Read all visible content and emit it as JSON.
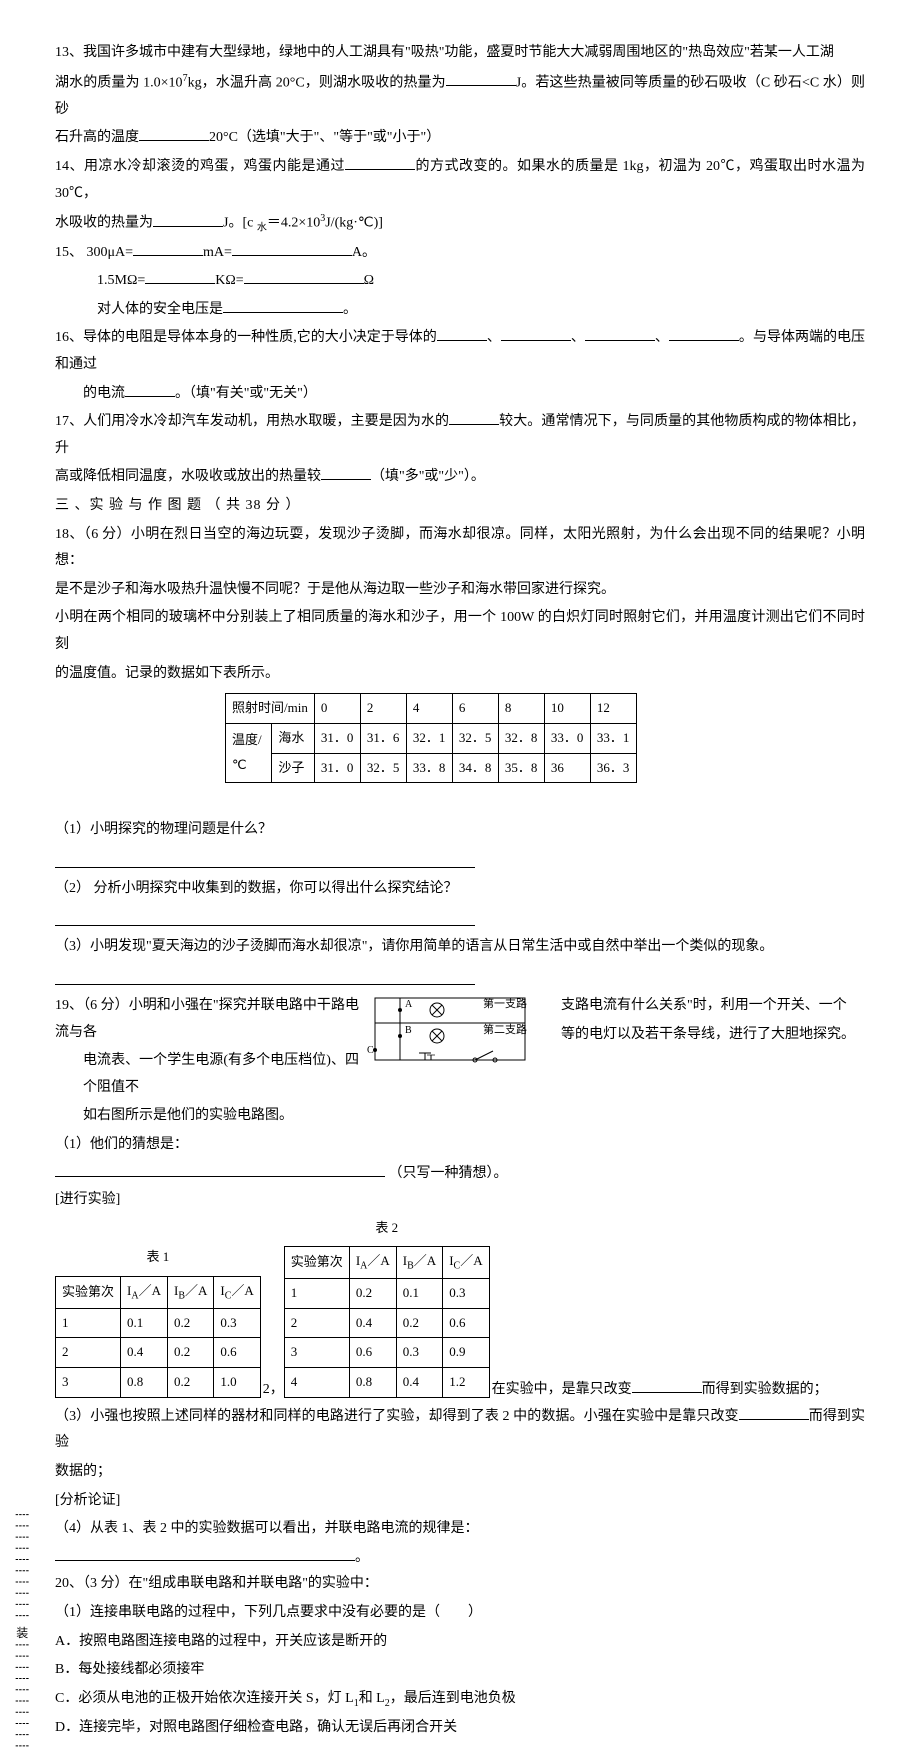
{
  "q13": {
    "line1": "13、我国许多城市中建有大型绿地，绿地中的人工湖具有\"吸热\"功能，盛夏时节能大大减弱周围地区的\"热岛效应\"若某一人工湖",
    "line2a": "湖水的质量为 1.0×10",
    "line2b": "kg，水温升高 20°C，则湖水吸收的热量为",
    "line2c": "J。若这些热量被同等质量的砂石吸收（C 砂石<C 水）则砂",
    "line3a": "石升高的温度",
    "line3b": "20°C（选填\"大于\"、\"等于\"或\"小于\"）"
  },
  "q14": {
    "line1a": "14、用凉水冷却滚烫的鸡蛋，鸡蛋内能是通过",
    "line1b": "的方式改变的。如果水的质量是 1kg，初温为 20℃，鸡蛋取出时水温为 30℃，",
    "line2a": "水吸收的热量为",
    "line2b": "J。[c ",
    "line2c": "＝4.2×10",
    "line2d": "J/(kg·℃)]",
    "sub_water": "水"
  },
  "q15": {
    "line1a": "15、 300μA=",
    "line1b": "mA=",
    "line1c": "A。",
    "line2a": "1.5MΩ=",
    "line2b": "KΩ=",
    "line2c": "Ω",
    "line3a": "对人体的安全电压是",
    "line3b": "。"
  },
  "q16": {
    "line1a": "16、导体的电阻是导体本身的一种性质,它的大小决定于导体的",
    "line1b": "、",
    "line1c": "、",
    "line1d": "、",
    "line1e": "。与导体两端的电压和通过",
    "line2a": "的电流",
    "line2b": "。（填\"有关\"或\"无关\"）"
  },
  "q17": {
    "line1a": "17、人们用冷水冷却汽车发动机，用热水取暖，主要是因为水的",
    "line1b": "较大。通常情况下，与同质量的其他物质构成的物体相比，升",
    "line2a": "高或降低相同温度，水吸收或放出的热量较",
    "line2b": "（填\"多\"或\"少\"）。"
  },
  "section3": "三 、实 验 与 作 图 题 （ 共 38 分 ）",
  "q18": {
    "line1": "18、（6 分）小明在烈日当空的海边玩耍，发现沙子烫脚，而海水却很凉。同样，太阳光照射，为什么会出现不同的结果呢？小明想：",
    "line2": "是不是沙子和海水吸热升温快慢不同呢？于是他从海边取一些沙子和海水带回家进行探究。",
    "line3": "小明在两个相同的玻璃杯中分别装上了相同质量的海水和沙子，用一个 100W 的白炽灯同时照射它们，并用温度计测出它们不同时刻",
    "line4": "的温度值。记录的数据如下表所示。",
    "table": {
      "header": [
        "照射时间/min",
        "0",
        "2",
        "4",
        "6",
        "8",
        "10",
        "12"
      ],
      "row1_label1": "温度/",
      "row1_label2": "℃",
      "row1_sub": "海水",
      "row1": [
        "31．0",
        "31．6",
        "32．1",
        "32．5",
        "32．8",
        "33．0",
        "33．1"
      ],
      "row2_sub": "沙子",
      "row2": [
        "31．0",
        "32．5",
        "33．8",
        "34．8",
        "35．8",
        "36",
        "36．3"
      ]
    },
    "sub1": "（1）小明探究的物理问题是什么？",
    "sub2": "（2） 分析小明探究中收集到的数据，你可以得出什么探究结论？",
    "sub3": "（3）小明发现\"夏天海边的沙子烫脚而海水却很凉\"，请你用简单的语言从日常生活中或自然中举出一个类似的现象。"
  },
  "q19": {
    "left1": "19、（6 分）小明和小强在\"探究并联电路中干路电流与各",
    "right1": "支路电流有什么关系\"时，利用一个开关、一个",
    "left2": "电流表、一个学生电源(有多个电压档位)、四个阻值不",
    "right2": "等的电灯以及若干条导线，进行了大胆地探究。",
    "left3": "如右图所示是他们的实验电路图。",
    "sub1a": "（1）他们的猜想是：",
    "sub1b": "（只写一种猜想）。",
    "subexp": "[进行实验]",
    "circuit_labels": {
      "a": "A",
      "b": "B",
      "c": "C",
      "b1": "第一支路",
      "b2": "第二支路"
    },
    "t1_caption": "表 1",
    "t2_caption": "表 2",
    "t1": {
      "header": [
        "实验第次",
        "I",
        "I",
        "I"
      ],
      "sub": [
        "A",
        "B",
        "C"
      ],
      "unit": "／A",
      "rows": [
        [
          "1",
          "0.1",
          "0.2",
          "0.3"
        ],
        [
          "2",
          "0.4",
          "0.2",
          "0.6"
        ],
        [
          "3",
          "0.8",
          "0.2",
          "1.0"
        ]
      ]
    },
    "t2": {
      "header": [
        "实验第次",
        "I",
        "I",
        "I"
      ],
      "sub": [
        "A",
        "B",
        "C"
      ],
      "unit": "／A",
      "rows": [
        [
          "1",
          "0.2",
          "0.1",
          "0.3"
        ],
        [
          "2",
          "0.4",
          "0.2",
          "0.6"
        ],
        [
          "3",
          "0.6",
          "0.3",
          "0.9"
        ],
        [
          "4",
          "0.8",
          "0.4",
          "1.2"
        ]
      ]
    },
    "trail2a": "2，",
    "trail2b": "在实验中，是靠只改变",
    "trail2c": "而得到实验数据的；",
    "sub3a": "（3）小强也按照上述同样的器材和同样的电路进行了实验，却得到了表 2 中的数据。小强在实验中是靠只改变",
    "sub3b": "而得到实验",
    "sub3c": "数据的；",
    "analysis": "[分析论证]",
    "sub4": "（4）从表 1、表 2 中的实验数据可以看出，并联电路电流的规律是：",
    "period": "。"
  },
  "q20": {
    "title": "20、（3 分）在\"组成串联电路和并联电路\"的实验中：",
    "sub1": "（1）连接串联电路的过程中，下列几点要求中没有必要的是（　　）",
    "optA": "A．按照电路图连接电路的过程中，开关应该是断开的",
    "optB": "B．每处接线都必须接牢",
    "optC_a": "C．必须从电池的正极开始依次连接开关 S，灯 L",
    "optC_b": "和 L",
    "optC_c": "，最后连到电池负极",
    "optD": "D．连接完毕，对照电路图仔细检查电路，确认无误后再闭合开关"
  },
  "side": {
    "char": "装",
    "dots": "┊┊┊┊┊┊┊┊┊┊"
  }
}
